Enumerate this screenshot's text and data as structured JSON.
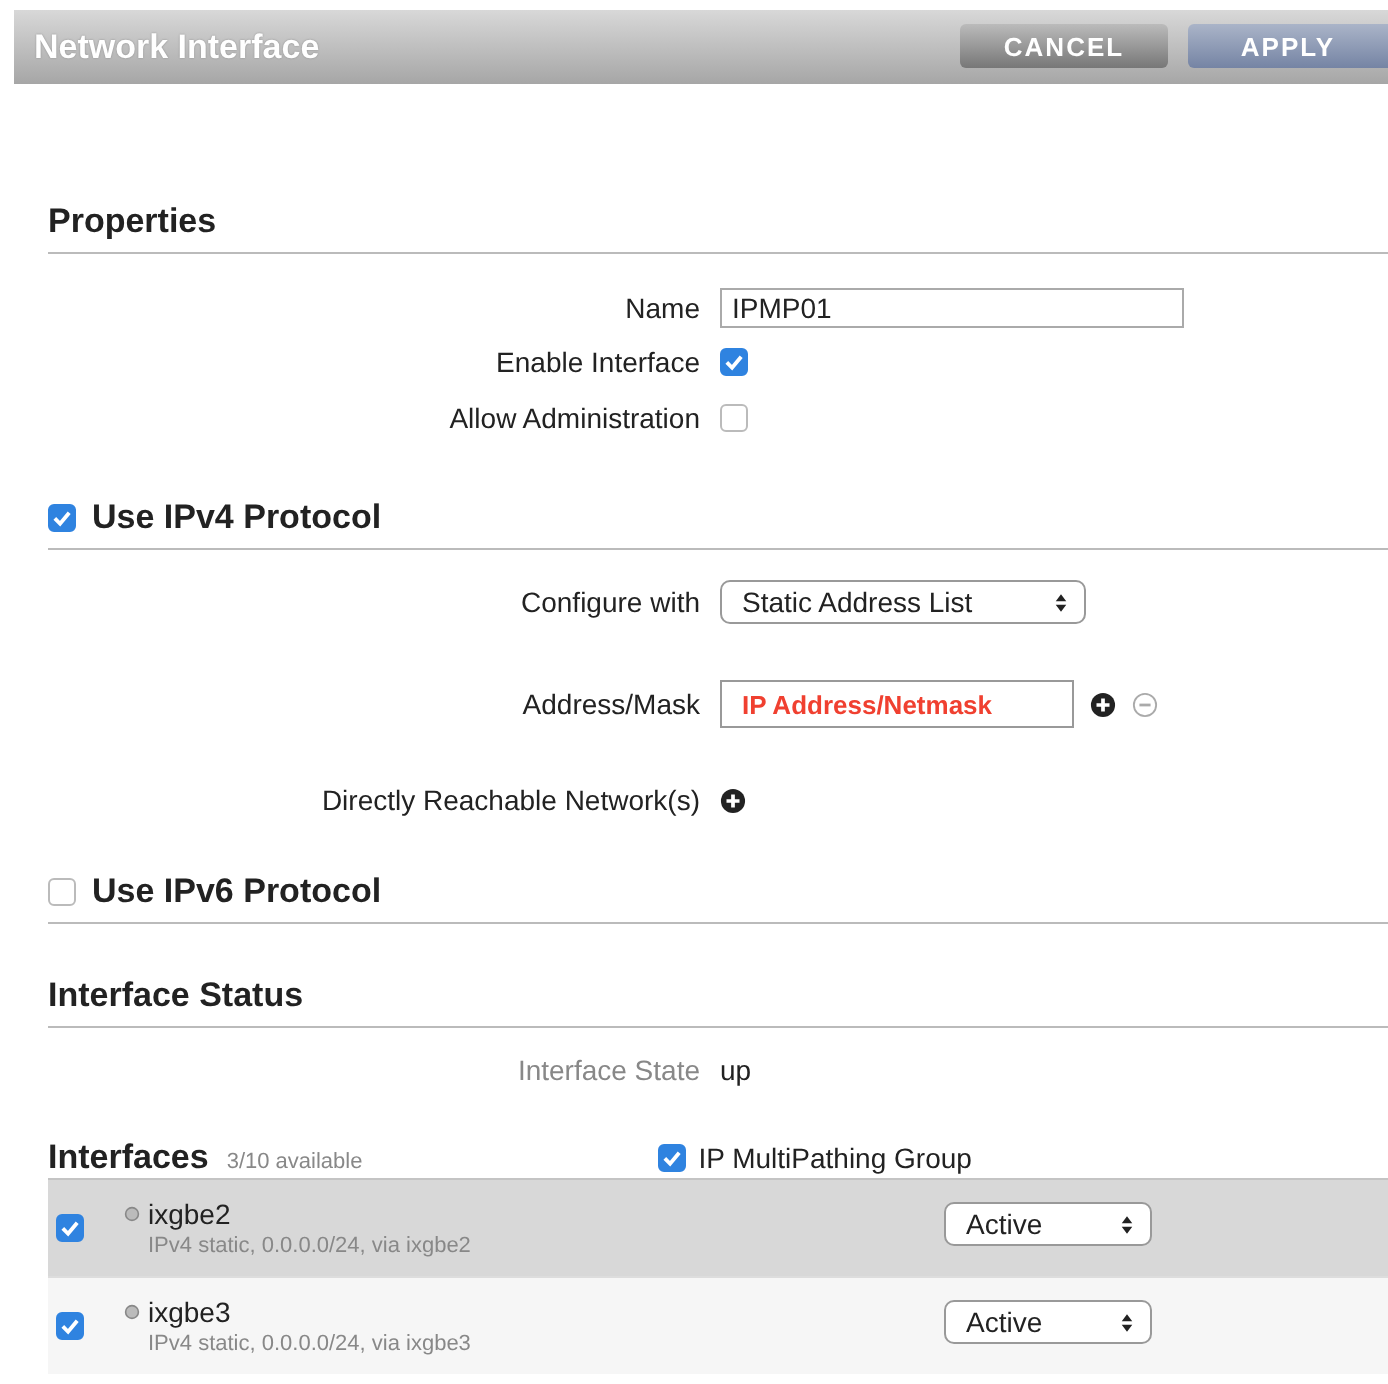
{
  "header": {
    "title": "Network Interface",
    "buttons": [
      {
        "label": "CANCEL",
        "kind": "cancel"
      },
      {
        "label": "APPLY",
        "kind": "apply"
      }
    ]
  },
  "properties": {
    "heading": "Properties",
    "name": {
      "label": "Name",
      "value": "IPMP01"
    },
    "options": [
      {
        "label": "Enable Interface",
        "checked": true
      },
      {
        "label": "Allow Administration",
        "checked": false
      }
    ]
  },
  "ipv4": {
    "heading": "Use IPv4 Protocol",
    "checked": true,
    "configure": {
      "label": "Configure with",
      "value": "Static Address List"
    },
    "address": {
      "label": "Address/Mask",
      "placeholder": "IP Address/Netmask",
      "invalid": true
    },
    "networks": {
      "label": "Directly Reachable Network(s)"
    }
  },
  "ipv6": {
    "heading": "Use IPv6 Protocol",
    "checked": false
  },
  "status": {
    "heading": "Interface Status",
    "state_label": "Interface State",
    "state_value": "up"
  },
  "interfaces": {
    "heading": "Interfaces",
    "count": "3/10 available",
    "ipmp": {
      "label": "IP MultiPathing Group",
      "checked": true
    },
    "rows": [
      {
        "name": "ixgbe2",
        "detail": "IPv4 static, 0.0.0.0/24, via ixgbe2",
        "checked": true,
        "selected": true,
        "mode": "Active"
      },
      {
        "name": "ixgbe3",
        "detail": "IPv4 static, 0.0.0.0/24, via ixgbe3",
        "checked": true,
        "selected": false,
        "mode": "Active"
      }
    ]
  }
}
